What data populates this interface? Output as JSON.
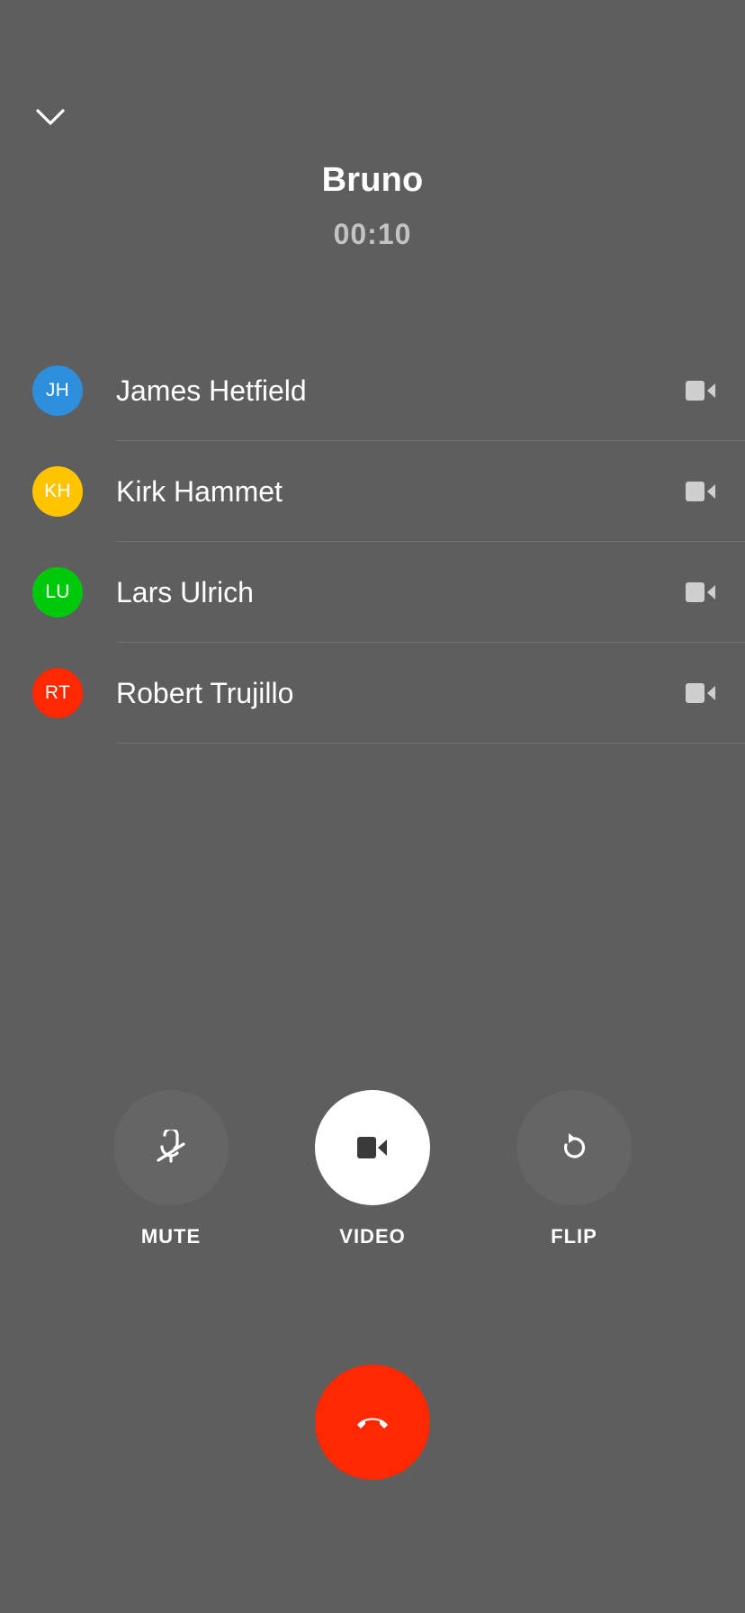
{
  "call": {
    "name": "Bruno",
    "timer": "00:10"
  },
  "participants": [
    {
      "initials": "JH",
      "name": "James Hetfield",
      "color": "#2d8fdc"
    },
    {
      "initials": "KH",
      "name": "Kirk Hammet",
      "color": "#fec400"
    },
    {
      "initials": "LU",
      "name": "Lars Ulrich",
      "color": "#00c80a"
    },
    {
      "initials": "RT",
      "name": "Robert Trujillo",
      "color": "#ff2800"
    }
  ],
  "controls": {
    "mute": {
      "label": "MUTE",
      "icon": "mic-off-icon",
      "active": false
    },
    "video": {
      "label": "VIDEO",
      "icon": "video-camera-icon",
      "active": true
    },
    "flip": {
      "label": "FLIP",
      "icon": "flip-camera-icon",
      "active": false
    }
  },
  "hangup": {
    "icon": "phone-hangup-icon",
    "color": "#ff2800"
  },
  "colors": {
    "background": "#5e5e5e",
    "control_off": "#656565",
    "video_icon_row": "#cfcfcf"
  }
}
